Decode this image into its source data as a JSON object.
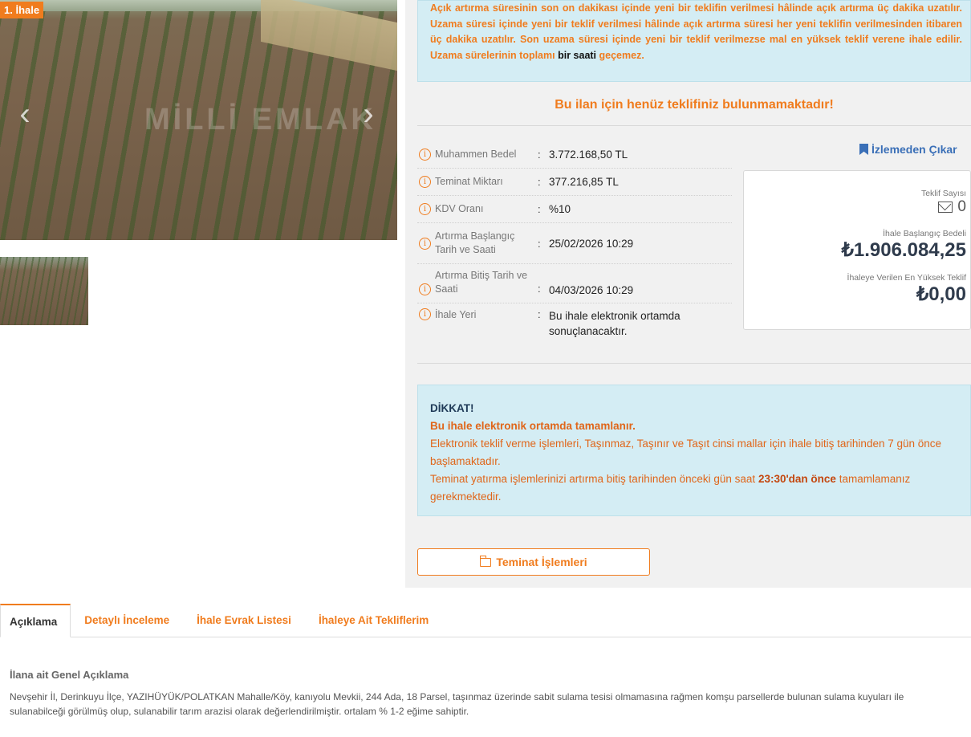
{
  "gallery": {
    "badge": "1. İhale",
    "watermark": "MİLLİ EMLAK",
    "prev_icon": "‹",
    "next_icon": "›"
  },
  "info_box": {
    "text_before": "Açık artırma süresinin son on dakikası içinde yeni bir teklifin verilmesi hâlinde açık artırma üç dakika uzatılır. Uzama süresi içinde yeni bir teklif verilmesi hâlinde açık artırma süresi her yeni teklifin verilmesinden itibaren üç dakika uzatılır. Son uzama süresi içinde yeni bir teklif verilmezse mal en yüksek teklif verene ihale edilir. Uzama sürelerinin toplamı",
    "highlight": "bir saati",
    "text_after": "geçemez."
  },
  "no_bid_message": "Bu ilan için henüz teklifiniz bulunmamaktadır!",
  "details": [
    {
      "label": "Muhammen Bedel",
      "value": "3.772.168,50 TL"
    },
    {
      "label": "Teminat Miktarı",
      "value": "377.216,85 TL"
    },
    {
      "label": "KDV Oranı",
      "value": "%10"
    },
    {
      "label": "Artırma Başlangıç Tarih ve Saati",
      "value": "25/02/2026 10:29"
    },
    {
      "label": "Artırma Bitiş Tarih ve Saati",
      "value": "04/03/2026 10:29"
    },
    {
      "label": "İhale Yeri",
      "value": "Bu ihale elektronik ortamda sonuçlanacaktır."
    }
  ],
  "unwatch_label": "İzlemeden Çıkar",
  "bid_card": {
    "offer_count_label": "Teklif Sayısı",
    "offer_count": "0",
    "start_price_label": "İhale Başlangıç Bedeli",
    "start_price": "₺1.906.084,25",
    "highest_bid_label": "İhaleye Verilen En Yüksek Teklif",
    "highest_bid": "₺0,00"
  },
  "alert": {
    "title": "DİKKAT!",
    "line1": "Bu ihale elektronik ortamda tamamlanır.",
    "line2": "Elektronik teklif verme işlemleri, Taşınmaz, Taşınır ve Taşıt cinsi mallar için ihale bitiş tarihinden 7 gün önce başlamaktadır.",
    "line3_before": "Teminat yatırma işlemlerinizi artırma bitiş tarihinden önceki gün saat",
    "line3_bold": "23:30'dan önce",
    "line3_after": "tamamlamanız gerekmektedir."
  },
  "guarantee_button": "Teminat İşlemleri",
  "tabs": [
    {
      "label": "Açıklama",
      "active": true
    },
    {
      "label": "Detaylı İnceleme",
      "active": false
    },
    {
      "label": "İhale Evrak Listesi",
      "active": false
    },
    {
      "label": "İhaleye Ait Tekliflerim",
      "active": false
    }
  ],
  "description": {
    "title": "İlana ait Genel Açıklama",
    "text": "Nevşehir İl, Derinkuyu İlçe, YAZIHÜYÜK/POLATKAN Mahalle/Köy, kanıyolu Mevkii, 244 Ada, 18 Parsel, taşınmaz üzerinde sabit sulama tesisi olmamasına rağmen komşu parsellerde bulunan sulama kuyuları ile sulanabilceği görülmüş olup, sulanabilir tarım arazisi olarak değerlendirilmiştir. ortalam % 1-2 eğime sahiptir."
  },
  "colors": {
    "accent": "#f07c1e",
    "info_bg": "#d4edf4",
    "link_blue": "#3a6fb7"
  }
}
